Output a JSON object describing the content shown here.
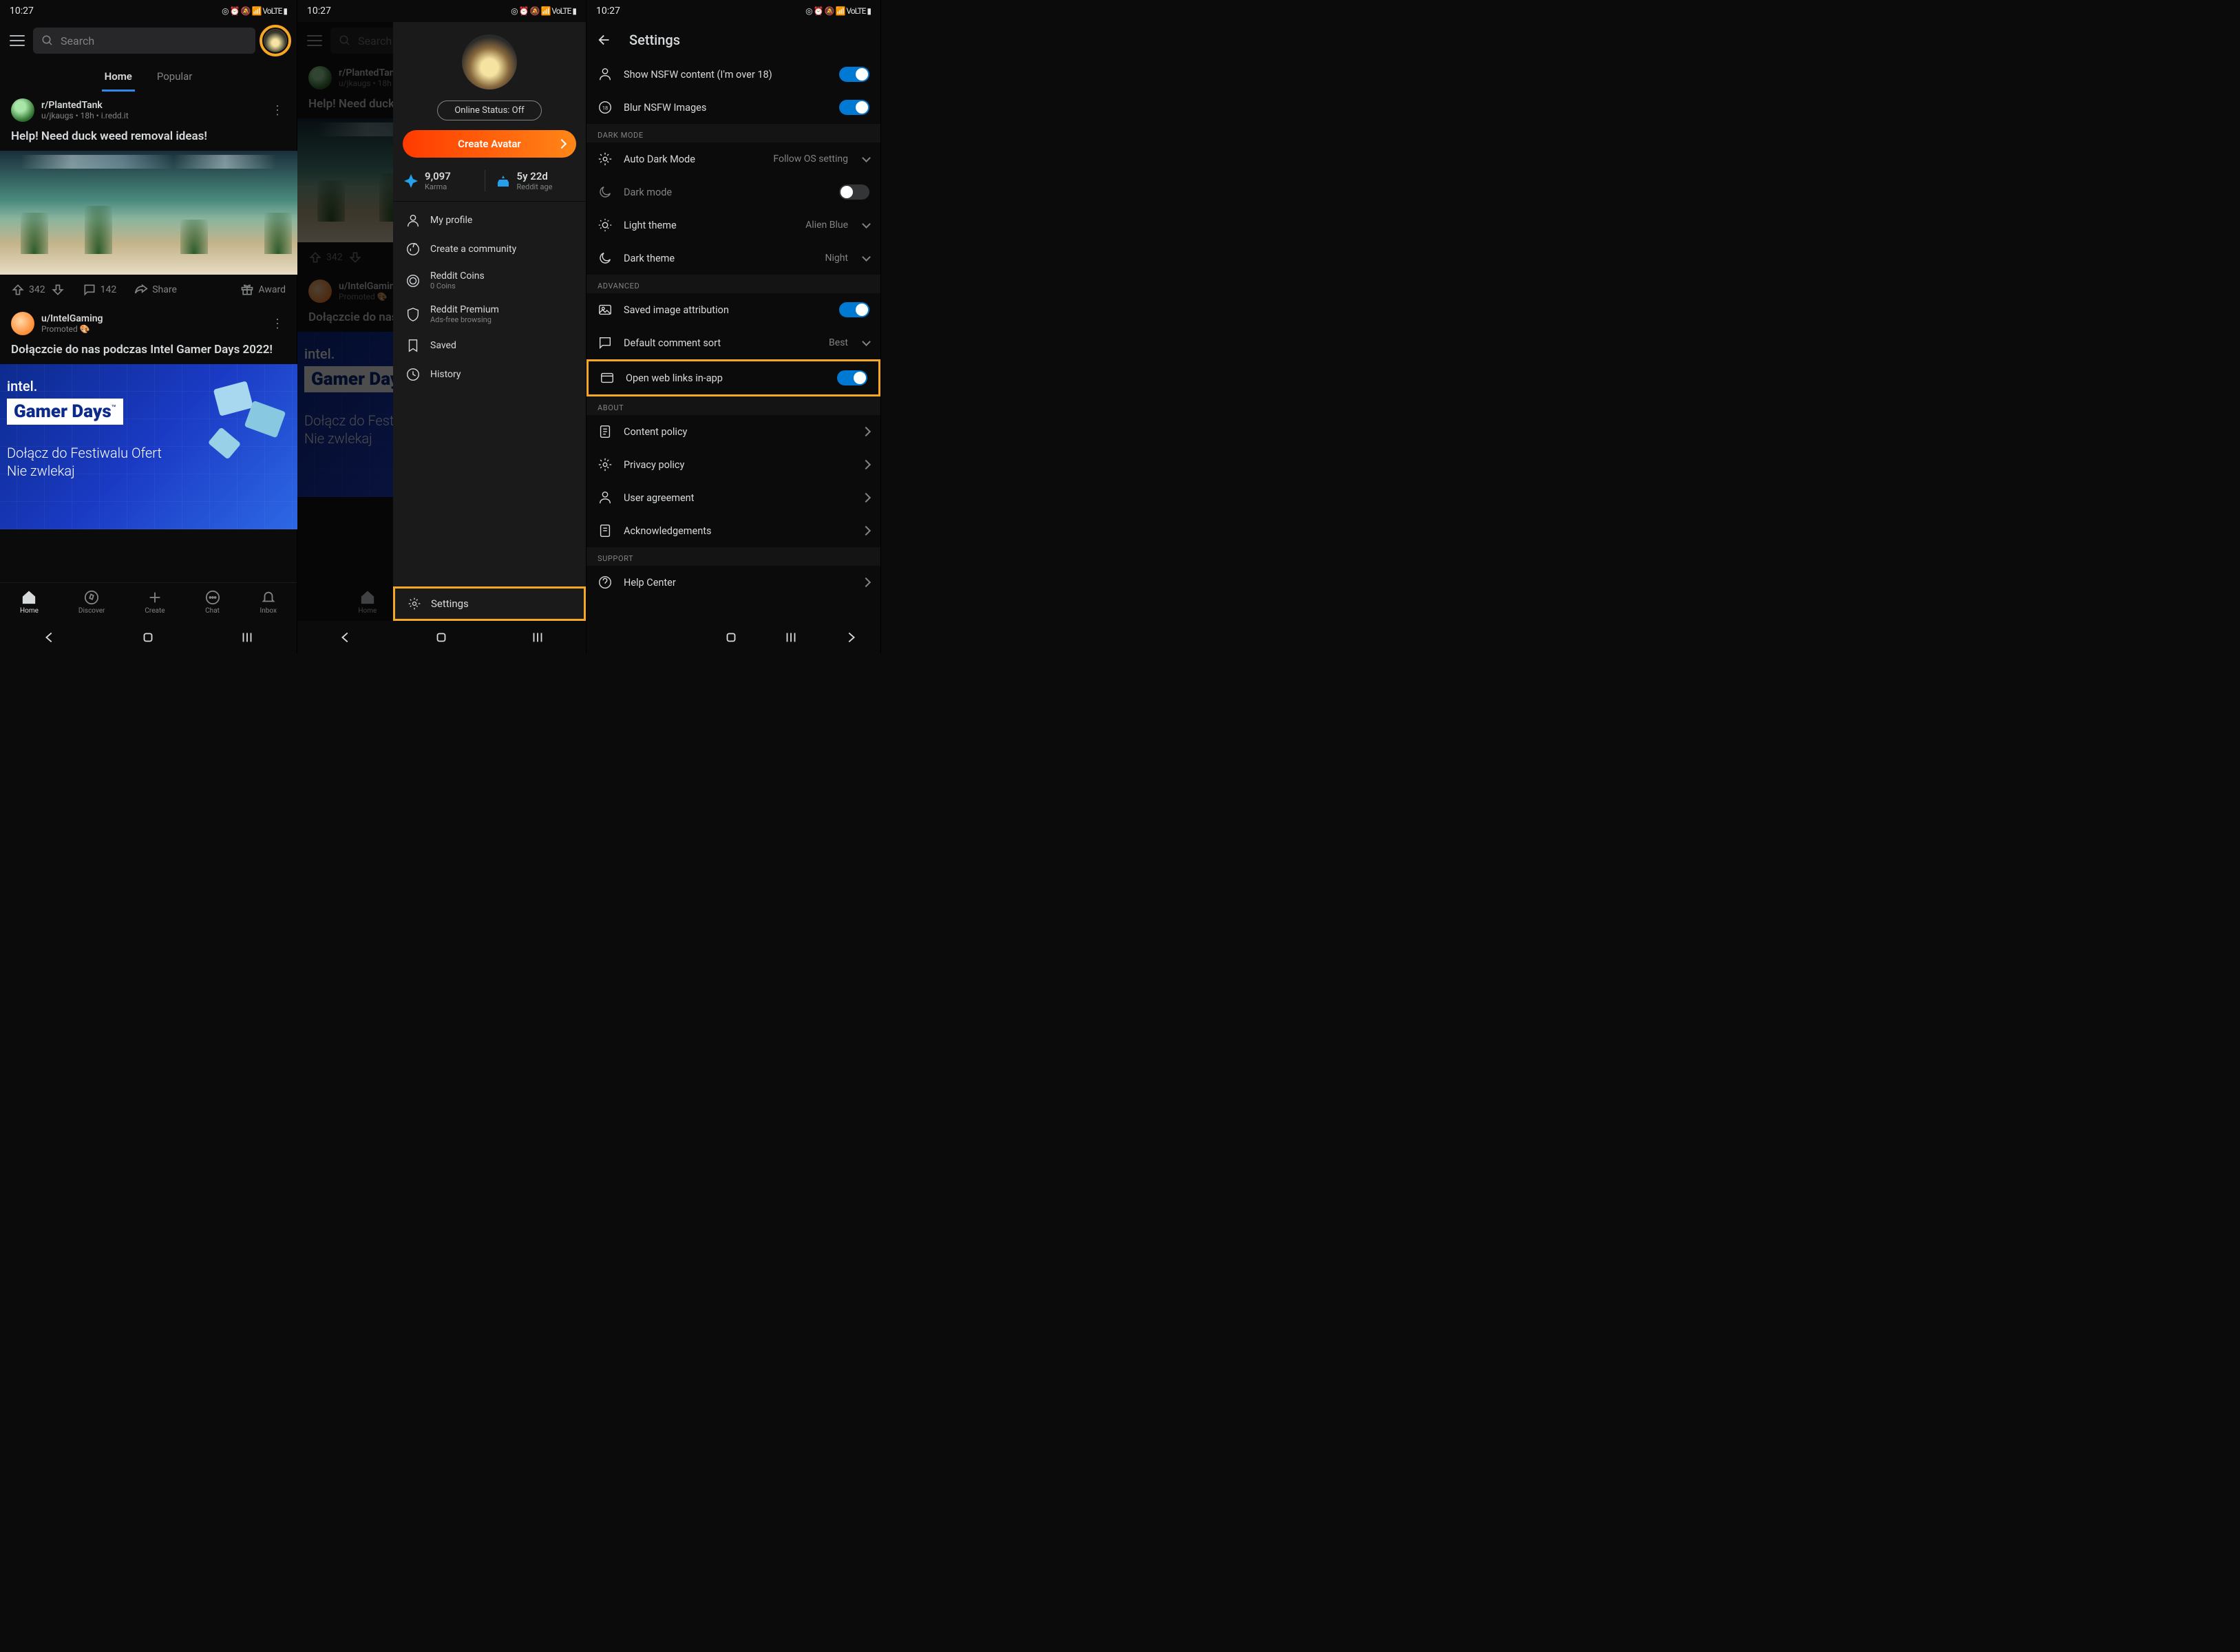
{
  "status": {
    "time": "10:27",
    "icons": "◎ ⏰ 🔕 📶 VoLTE ▮"
  },
  "common": {
    "search_placeholder": "Search",
    "tabs": {
      "home": "Home",
      "popular": "Popular"
    },
    "bottom_nav": {
      "home": "Home",
      "discover": "Discover",
      "create": "Create",
      "chat": "Chat",
      "inbox": "Inbox"
    }
  },
  "feed": {
    "post1": {
      "subreddit": "r/PlantedTank",
      "meta": "u/jkaugs • 18h • i.redd.it",
      "title": "Help! Need duck weed removal ideas!",
      "upvotes": "342",
      "comments": "142",
      "share": "Share",
      "award": "Award"
    },
    "post2": {
      "user": "u/IntelGaming",
      "meta": "Promoted 🎨",
      "title": "Dołączcie do nas podczas Intel Gamer Days 2022!",
      "promo_brand": "intel.",
      "promo_title": "Gamer Days",
      "promo_sub1": "Dołącz do Festiwalu Ofert",
      "promo_sub2": "Nie zwlekaj"
    }
  },
  "drawer": {
    "online_status": "Online Status: Off",
    "create_avatar": "Create Avatar",
    "karma_value": "9,097",
    "karma_label": "Karma",
    "age_value": "5y 22d",
    "age_label": "Reddit age",
    "items": [
      {
        "label": "My profile"
      },
      {
        "label": "Create a community"
      },
      {
        "label": "Reddit Coins",
        "sub": "0 Coins"
      },
      {
        "label": "Reddit Premium",
        "sub": "Ads-free browsing"
      },
      {
        "label": "Saved"
      },
      {
        "label": "History"
      }
    ],
    "settings": "Settings"
  },
  "settings": {
    "title": "Settings",
    "show_nsfw": "Show NSFW content (I'm over 18)",
    "blur_nsfw": "Blur NSFW Images",
    "section_dark": "DARK MODE",
    "auto_dark": "Auto Dark Mode",
    "auto_dark_val": "Follow OS setting",
    "dark_mode": "Dark mode",
    "light_theme": "Light theme",
    "light_theme_val": "Alien Blue",
    "dark_theme": "Dark theme",
    "dark_theme_val": "Night",
    "section_adv": "ADVANCED",
    "saved_attr": "Saved image attribution",
    "default_sort": "Default comment sort",
    "default_sort_val": "Best",
    "open_links": "Open web links in-app",
    "section_about": "ABOUT",
    "content_policy": "Content policy",
    "privacy_policy": "Privacy policy",
    "user_agreement": "User agreement",
    "ack": "Acknowledgements",
    "section_support": "SUPPORT",
    "help_center": "Help Center"
  }
}
